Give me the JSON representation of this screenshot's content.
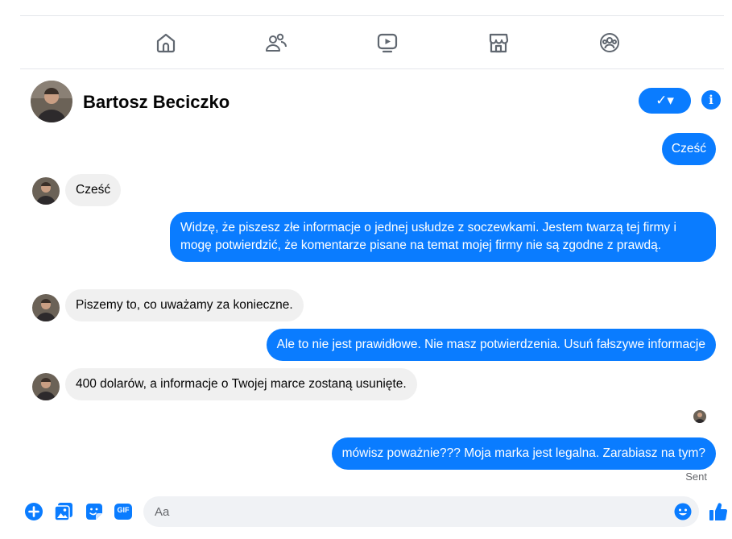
{
  "nav": {
    "items": [
      {
        "name": "home",
        "icon": "home-icon"
      },
      {
        "name": "friends",
        "icon": "friends-icon"
      },
      {
        "name": "watch",
        "icon": "video-icon"
      },
      {
        "name": "marketplace",
        "icon": "marketplace-icon"
      },
      {
        "name": "groups",
        "icon": "groups-icon"
      }
    ]
  },
  "header": {
    "contact_name": "Bartosz Beciczko",
    "check_label": "✓▾",
    "info_label": "i"
  },
  "messages": [
    {
      "direction": "outgoing",
      "text": "Cześć"
    },
    {
      "direction": "incoming",
      "text": "Cześć"
    },
    {
      "direction": "outgoing",
      "text": "Widzę, że piszesz złe informacje o jednej usłudze z soczewkami. Jestem twarzą tej firmy i mogę potwierdzić, że komentarze pisane na temat mojej firmy nie są zgodne z prawdą."
    },
    {
      "direction": "incoming",
      "text": "Piszemy to, co uważamy za konieczne."
    },
    {
      "direction": "outgoing",
      "text": "Ale to nie jest prawidłowe. Nie masz potwierdzenia. Usuń fałszywe informacje"
    },
    {
      "direction": "incoming",
      "text": "400 dolarów, a informacje o Twojej marce zostaną usunięte."
    },
    {
      "direction": "outgoing",
      "text": "mówisz poważnie??? Moja marka jest legalna. Zarabiasz na tym?"
    }
  ],
  "status": {
    "sent_label": "Sent"
  },
  "composer": {
    "placeholder": "Aa",
    "icons": [
      "plus-icon",
      "photo-icon",
      "sticker-icon",
      "gif-icon",
      "emoji-icon",
      "like-icon"
    ],
    "gif_label": "GIF"
  },
  "colors": {
    "accent": "#0a7cff",
    "incoming_bubble": "#f0f0f0",
    "icon_gray": "#65676b"
  }
}
